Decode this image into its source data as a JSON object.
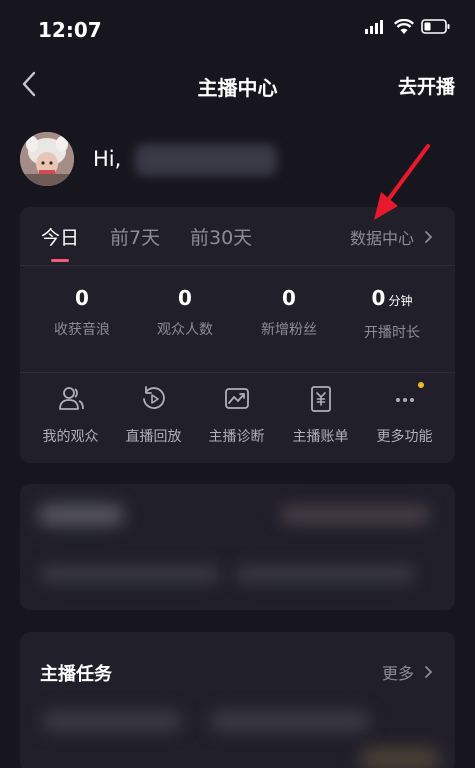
{
  "status_bar": {
    "time": "12:07"
  },
  "nav": {
    "title": "主播中心",
    "action": "去开播"
  },
  "profile": {
    "greeting": "Hi,"
  },
  "tabs": [
    {
      "label": "今日",
      "active": true
    },
    {
      "label": "前7天",
      "active": false
    },
    {
      "label": "前30天",
      "active": false
    }
  ],
  "data_center": {
    "label": "数据中心"
  },
  "stats": [
    {
      "value": "0",
      "unit": "",
      "label": "收获音浪"
    },
    {
      "value": "0",
      "unit": "",
      "label": "观众人数"
    },
    {
      "value": "0",
      "unit": "",
      "label": "新增粉丝"
    },
    {
      "value": "0",
      "unit": "分钟",
      "label": "开播时长"
    }
  ],
  "functions": [
    {
      "label": "我的观众",
      "icon": "audience-icon"
    },
    {
      "label": "直播回放",
      "icon": "replay-icon"
    },
    {
      "label": "主播诊断",
      "icon": "diagnosis-icon"
    },
    {
      "label": "主播账单",
      "icon": "bill-icon"
    },
    {
      "label": "更多功能",
      "icon": "more-icon",
      "badge": true
    }
  ],
  "task_card": {
    "title": "主播任务",
    "more": "更多"
  },
  "colors": {
    "background": "#17161f",
    "card": "#201f2a",
    "accent": "#f2597a",
    "muted": "#8d8c96",
    "badge": "#f6b627",
    "annotation": "#e8192c"
  }
}
